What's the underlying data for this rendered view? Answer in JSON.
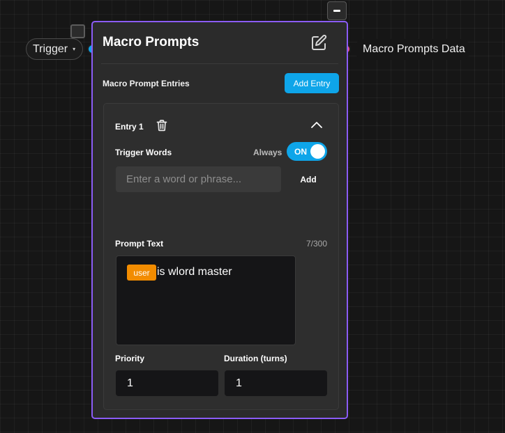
{
  "canvas": {
    "trigger_label": "Trigger",
    "trigger_caret": "▾",
    "output_label": "Macro Prompts Data"
  },
  "node": {
    "title": "Macro Prompts",
    "entries_label": "Macro Prompt Entries",
    "add_entry_label": "Add Entry",
    "border_color": "#8b5cf6",
    "entry": {
      "title": "Entry 1",
      "trigger_words_label": "Trigger Words",
      "always_label": "Always",
      "toggle_text": "ON",
      "word_input_placeholder": "Enter a word or phrase...",
      "word_input_value": "",
      "add_word_label": "Add",
      "prompt_text_label": "Prompt Text",
      "char_count": "7/300",
      "user_tag": "user",
      "prompt_text": "is wlord master",
      "priority_label": "Priority",
      "priority_value": "1",
      "duration_label": "Duration (turns)",
      "duration_value": "1"
    }
  },
  "colors": {
    "accent": "#0ea5e9",
    "input_port": "#0ea5e9",
    "output_port": "#e8508f",
    "user_tag": "#f28c00"
  },
  "icons": [
    "minus-icon",
    "edit-icon",
    "trash-icon",
    "chevron-up-icon",
    "caret-down-icon"
  ]
}
